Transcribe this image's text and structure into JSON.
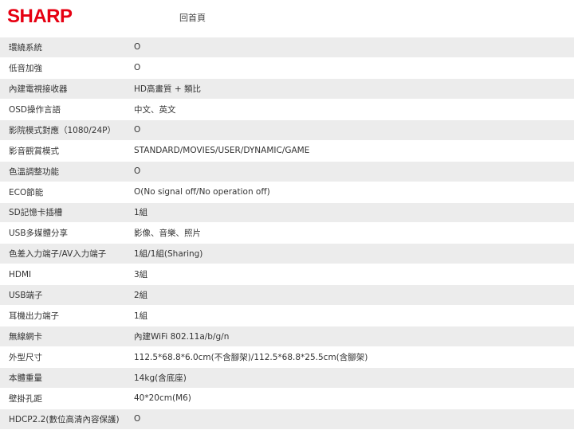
{
  "header": {
    "logo_text": "SHARP",
    "home_label": "回首頁"
  },
  "specs": [
    {
      "label": "環繞系統",
      "value": "O"
    },
    {
      "label": "低音加強",
      "value": "O"
    },
    {
      "label": "內建電視接收器",
      "value": "HD高畫質 + 類比"
    },
    {
      "label": "OSD操作言語",
      "value": "中文、英文"
    },
    {
      "label": "影院模式對應（1080/24P）",
      "value": "O"
    },
    {
      "label": "影音觀賞模式",
      "value": "STANDARD/MOVIES/USER/DYNAMIC/GAME"
    },
    {
      "label": "色溫調整功能",
      "value": "O"
    },
    {
      "label": "ECO節能",
      "value": "O(No signal off/No operation off)"
    },
    {
      "label": "SD記憶卡插槽",
      "value": "1組"
    },
    {
      "label": "USB多媒體分享",
      "value": "影像、音樂、照片"
    },
    {
      "label": "色差入力端子/AV入力端子",
      "value": "1組/1組(Sharing)"
    },
    {
      "label": "HDMI",
      "value": "3組"
    },
    {
      "label": "USB端子",
      "value": "2組"
    },
    {
      "label": "耳機出力端子",
      "value": "1組"
    },
    {
      "label": "無線網卡",
      "value": "內建WiFi 802.11a/b/g/n"
    },
    {
      "label": "外型尺寸",
      "value": "112.5*68.8*6.0cm(不含腳架)/112.5*68.8*25.5cm(含腳架)"
    },
    {
      "label": "本體重量",
      "value": "14kg(含底座)"
    },
    {
      "label": "壁掛孔距",
      "value": "40*20cm(M6)"
    },
    {
      "label": "HDCP2.2(數位高清內容保護)",
      "value": "O"
    }
  ]
}
